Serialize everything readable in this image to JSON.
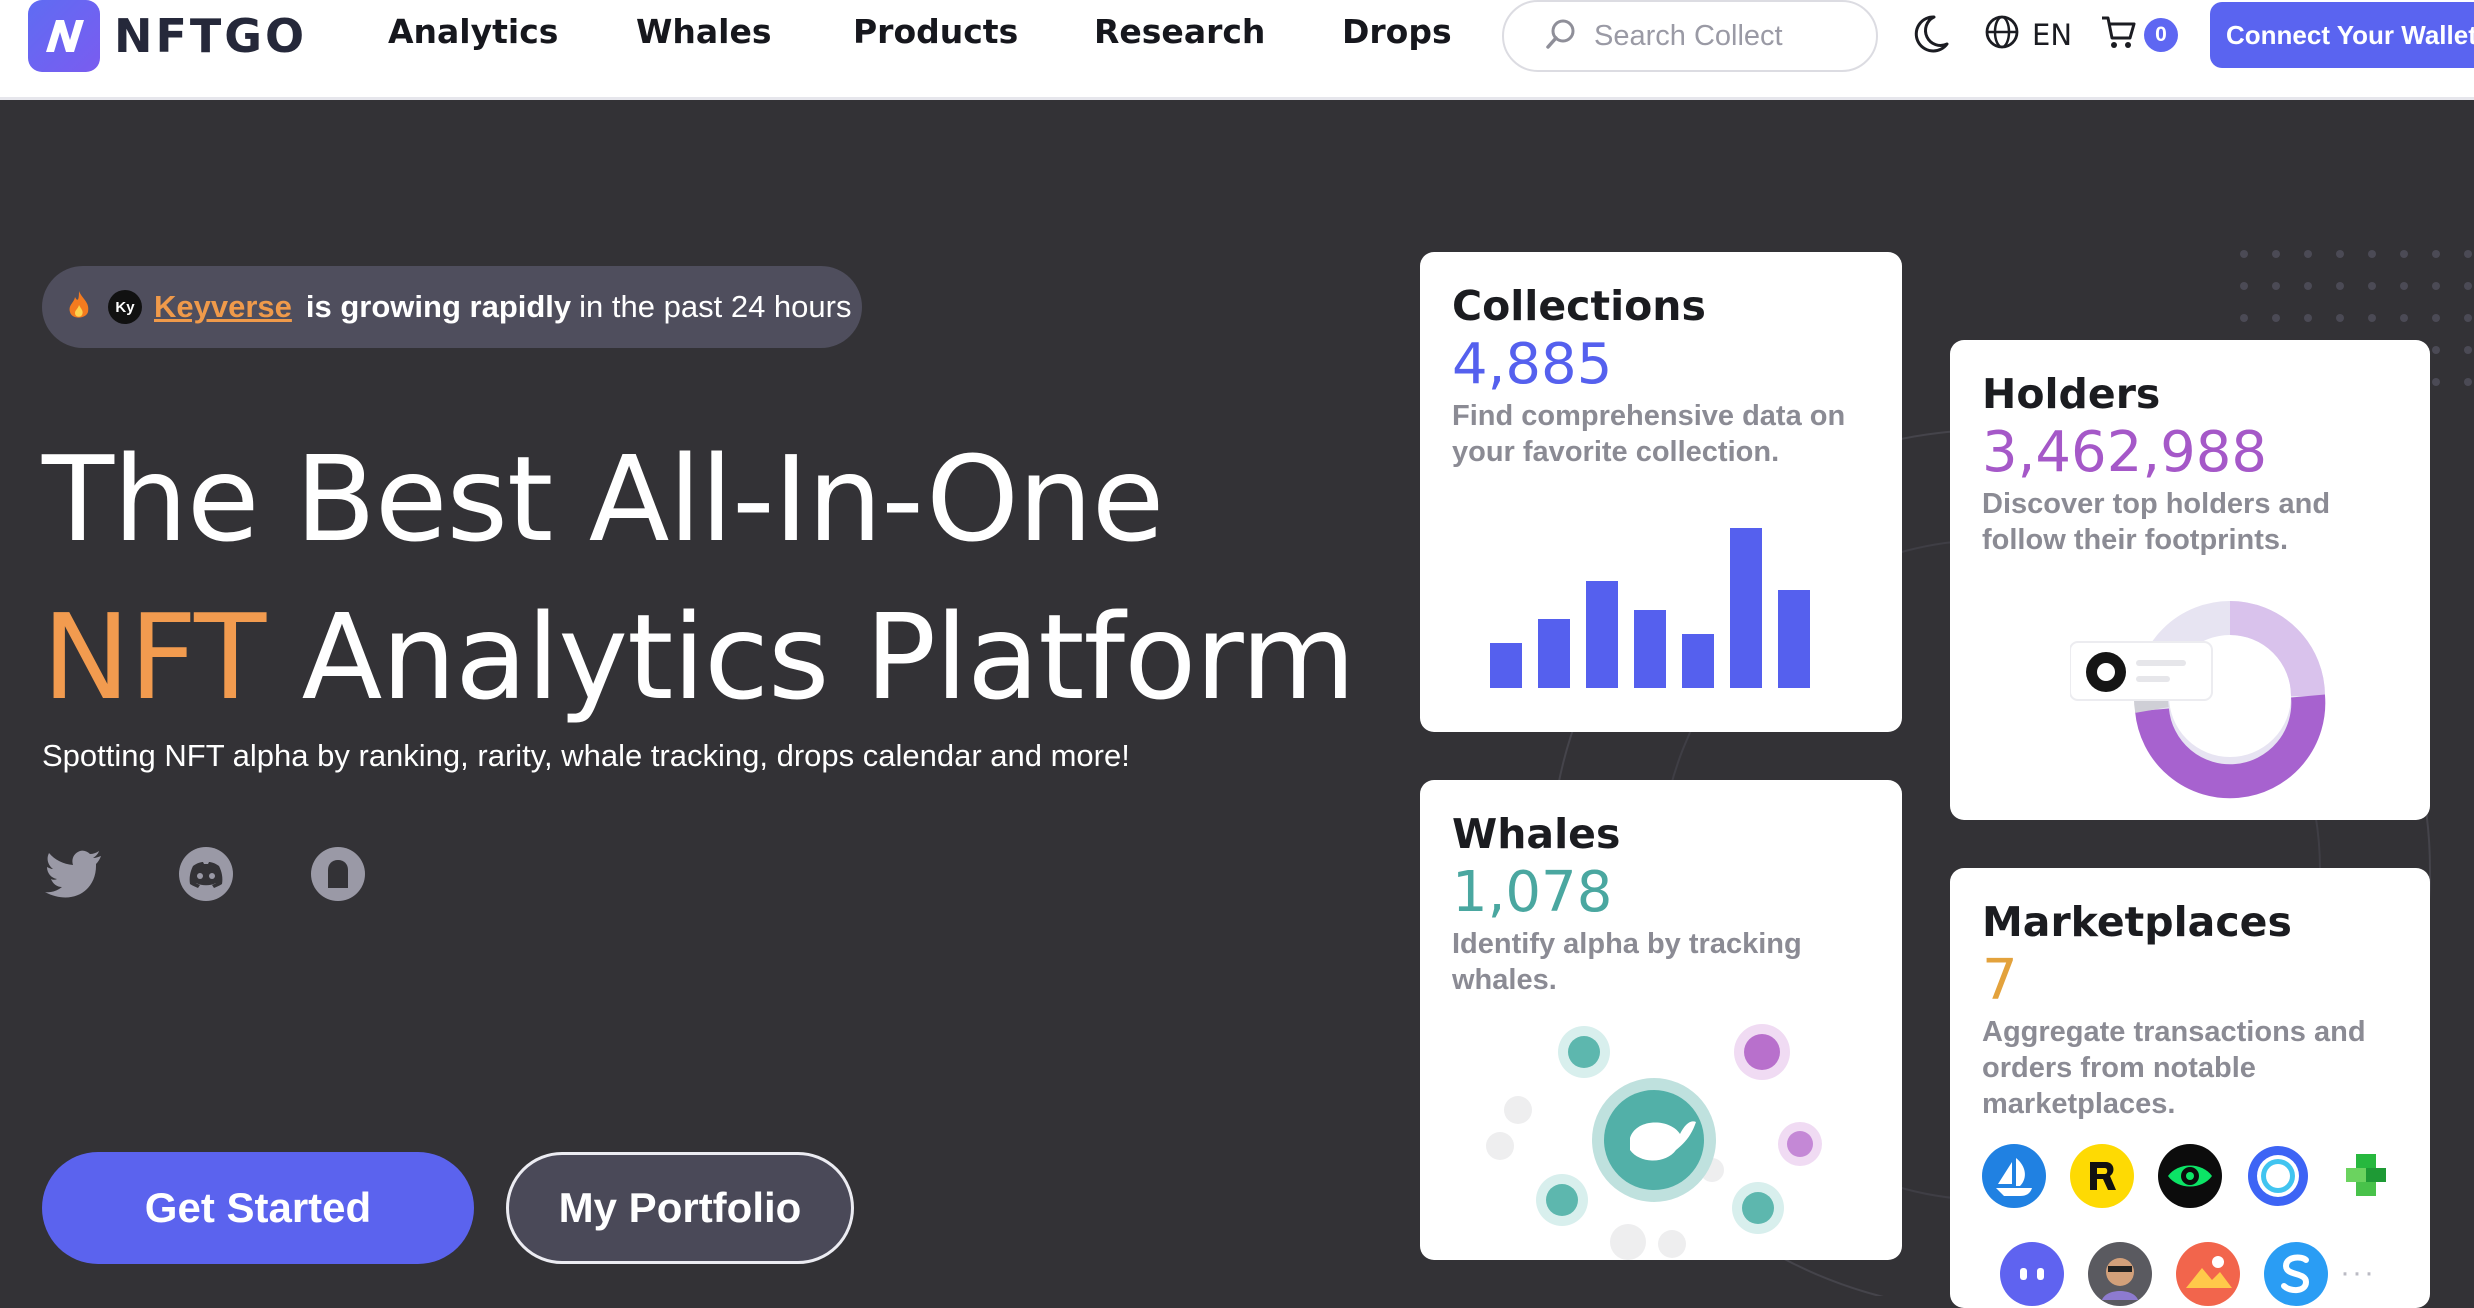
{
  "brand": {
    "name": "NFTGO"
  },
  "nav": {
    "items": [
      "Analytics",
      "Whales",
      "Products",
      "Research",
      "Drops"
    ],
    "search_placeholder": "Search Collect",
    "language": "EN",
    "cart_count": "0",
    "connect_label": "Connect Your Wallet"
  },
  "hero": {
    "trend": {
      "name": "Keyverse",
      "emphasis": "is growing rapidly",
      "rest": "in the past 24 hours"
    },
    "title_line1": "The Best All-In-One",
    "title_accent": "NFT",
    "title_line2_rest": "Analytics Platform",
    "subtitle": "Spotting NFT alpha by ranking, rarity, whale tracking, drops calendar and more!",
    "primary_button": "Get Started",
    "secondary_button": "My Portfolio",
    "social_icons": [
      "twitter-icon",
      "discord-icon",
      "notification-icon"
    ]
  },
  "cards": {
    "collections": {
      "title": "Collections",
      "number": "4,885",
      "description": "Find comprehensive data on your favorite collection.",
      "color": "#5560ee",
      "bars": [
        0.28,
        0.43,
        0.67,
        0.49,
        0.34,
        1.0,
        0.61
      ]
    },
    "holders": {
      "title": "Holders",
      "number": "3,462,988",
      "description": "Discover top holders and follow their footprints.",
      "color": "#a558c8"
    },
    "whales": {
      "title": "Whales",
      "number": "1,078",
      "description": "Identify alpha by tracking whales.",
      "color": "#4aa7a0"
    },
    "marketplaces": {
      "title": "Marketplaces",
      "number": "7",
      "description": "Aggregate transactions and orders from notable marketplaces.",
      "color": "#e3a23c",
      "icon_row1": [
        "opensea-icon",
        "rarible-icon",
        "looksrare-icon",
        "x2y2-icon",
        "cryptopunks-icon"
      ],
      "icon_row2": [
        "sudoswap-icon",
        "avatar-icon",
        "superrare-icon",
        "sound-icon"
      ]
    }
  }
}
